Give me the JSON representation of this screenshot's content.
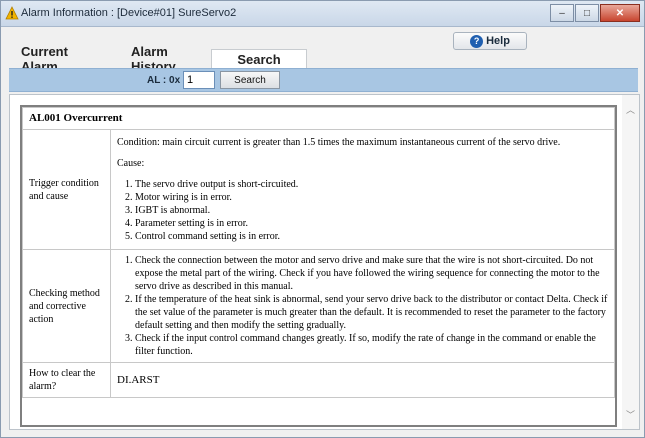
{
  "window": {
    "title": "Alarm Information : [Device#01] SureServo2",
    "minimize_label": "–",
    "maximize_label": "□",
    "close_label": "✕"
  },
  "help": {
    "label": "Help"
  },
  "tabs": [
    {
      "label": "Current Alarm"
    },
    {
      "label": "Alarm History"
    },
    {
      "label": "Search"
    }
  ],
  "search": {
    "prefix_label": "AL : 0x",
    "value": "1",
    "button_label": "Search"
  },
  "alarm": {
    "title": "AL001 Overcurrent",
    "rows": [
      {
        "label": "Trigger condition and cause",
        "condition": "Condition: main circuit current is greater than 1.5 times the maximum instantaneous current of the servo drive.",
        "cause_label": "Cause:",
        "items": [
          "The servo drive output is short-circuited.",
          "Motor wiring is in error.",
          "IGBT is abnormal.",
          "Parameter setting is in error.",
          "Control command setting is in error."
        ]
      },
      {
        "label": "Checking method and corrective action",
        "items": [
          "Check the connection between the motor and servo drive and make sure that the wire is not short-circuited. Do not expose the metal part of the wiring. Check if you have followed the wiring sequence for connecting the motor to the servo drive as described in this manual.",
          "If the temperature of the heat sink is abnormal, send your servo drive back to the distributor or contact Delta. Check if the set value of the parameter is much greater than the default. It is recommended to reset the parameter to the factory default setting and then modify the setting gradually.",
          "Check if the input control command changes greatly. If so, modify the rate of change in the command or enable the filter function."
        ]
      },
      {
        "label": "How to clear the alarm?",
        "value": "DI.ARST"
      }
    ]
  },
  "colors": {
    "search_bar": "#a8c6e3",
    "warning_icon": "#f2b400",
    "help_icon": "#1f5fb0"
  }
}
